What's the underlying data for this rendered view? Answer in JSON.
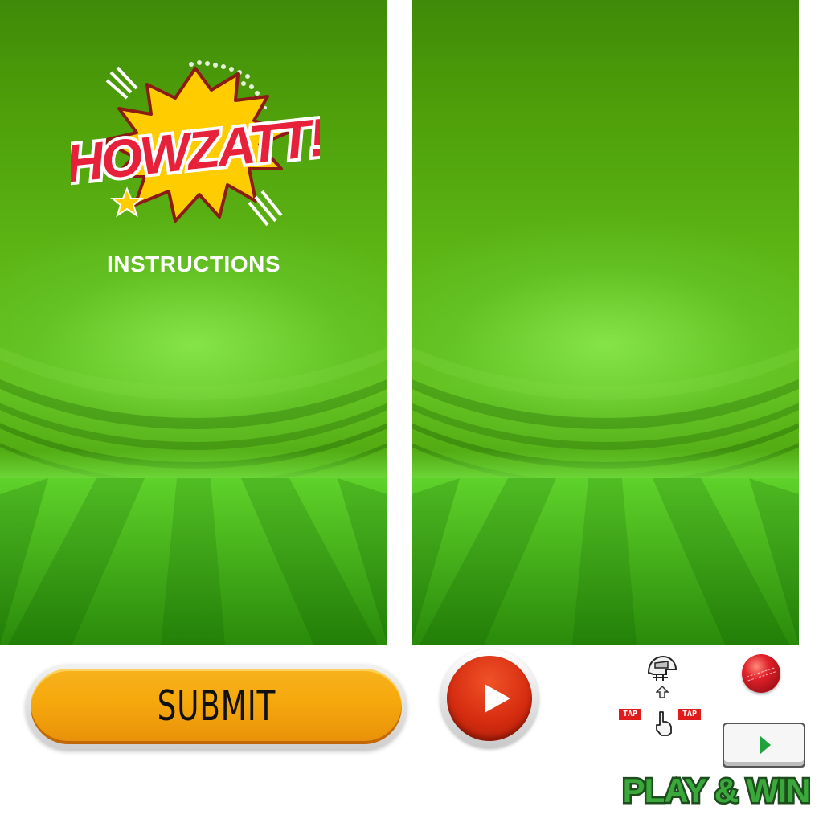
{
  "logo": {
    "text": "HOWZATT!"
  },
  "instructions": {
    "title": "INSTRUCTIONS"
  },
  "submit": {
    "label": "SUBMIT"
  },
  "tap_left": {
    "label": "TAP"
  },
  "tap_right": {
    "label": "TAP"
  },
  "play_win": {
    "text": "PLAY & WIN"
  },
  "colors": {
    "field_green": "#5cb515",
    "logo_burst": "#ffcc00",
    "logo_text_red": "#e8213b",
    "submit_orange": "#f5a80c",
    "play_red": "#d62d10",
    "small_play_green": "#1ea33a",
    "play_win_green": "#3aa83a"
  },
  "icons": [
    "helmet-icon",
    "up-arrow-icon",
    "tap-hand-icon",
    "cricket-ball-icon",
    "play-icon"
  ]
}
